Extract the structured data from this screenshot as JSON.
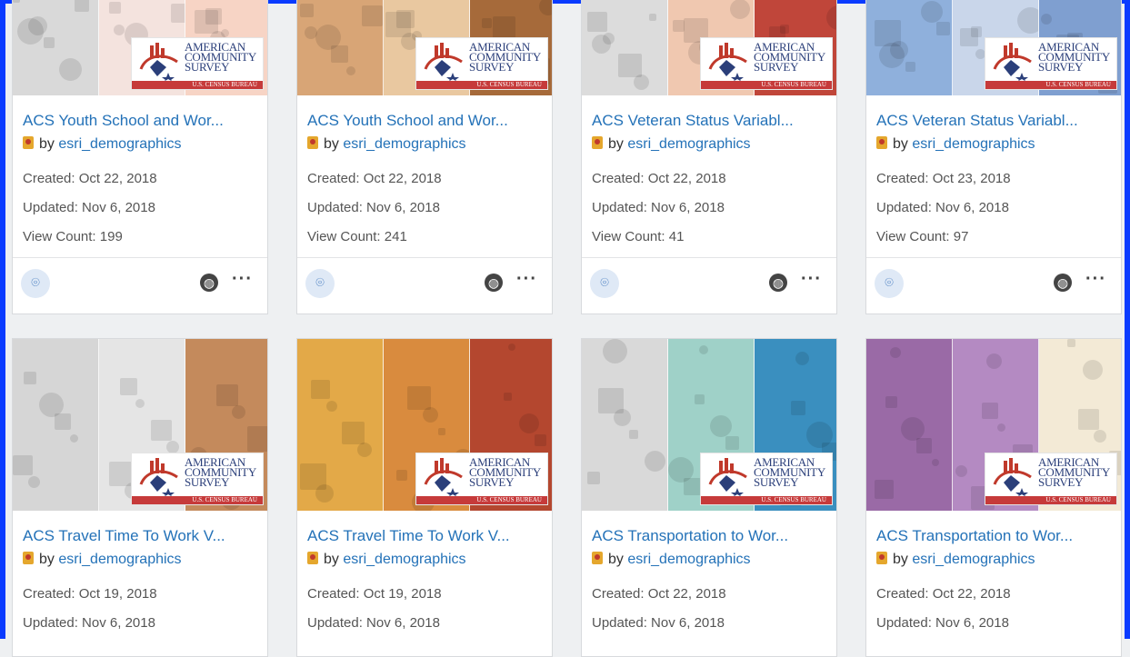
{
  "cards": [
    {
      "title": "ACS Youth School and Wor...",
      "owner_prefix": "by",
      "owner": "esri_demographics",
      "created": "Created: Oct 22, 2018",
      "updated": "Updated: Nov 6, 2018",
      "views": "View Count: 199",
      "thumb_colors": [
        "#d9d9d9",
        "#f4e3de",
        "#f7d4c5"
      ]
    },
    {
      "title": "ACS Youth School and Wor...",
      "owner_prefix": "by",
      "owner": "esri_demographics",
      "created": "Created: Oct 22, 2018",
      "updated": "Updated: Nov 6, 2018",
      "views": "View Count: 241",
      "thumb_colors": [
        "#d8a576",
        "#e9c8a0",
        "#a66a3a"
      ]
    },
    {
      "title": "ACS Veteran Status Variabl...",
      "owner_prefix": "by",
      "owner": "esri_demographics",
      "created": "Created: Oct 22, 2018",
      "updated": "Updated: Nov 6, 2018",
      "views": "View Count: 41",
      "thumb_colors": [
        "#dcdcdc",
        "#f0c8b0",
        "#c0463a"
      ]
    },
    {
      "title": "ACS Veteran Status Variabl...",
      "owner_prefix": "by",
      "owner": "esri_demographics",
      "created": "Created: Oct 23, 2018",
      "updated": "Updated: Nov 6, 2018",
      "views": "View Count: 97",
      "thumb_colors": [
        "#8fb0dc",
        "#c9d6ea",
        "#7f9fd0"
      ]
    },
    {
      "title": "ACS Travel Time To Work V...",
      "owner_prefix": "by",
      "owner": "esri_demographics",
      "created": "Created: Oct 19, 2018",
      "updated": "Updated: Nov 6, 2018",
      "views": "",
      "thumb_colors": [
        "#d6d6d6",
        "#e5e5e5",
        "#c48a5c"
      ]
    },
    {
      "title": "ACS Travel Time To Work V...",
      "owner_prefix": "by",
      "owner": "esri_demographics",
      "created": "Created: Oct 19, 2018",
      "updated": "Updated: Nov 6, 2018",
      "views": "",
      "thumb_colors": [
        "#e3a948",
        "#d98b3e",
        "#b4472f"
      ]
    },
    {
      "title": "ACS Transportation to Wor...",
      "owner_prefix": "by",
      "owner": "esri_demographics",
      "created": "Created: Oct 22, 2018",
      "updated": "Updated: Nov 6, 2018",
      "views": "",
      "thumb_colors": [
        "#d9d9d9",
        "#9fd1c8",
        "#3a8fbf"
      ]
    },
    {
      "title": "ACS Transportation to Wor...",
      "owner_prefix": "by",
      "owner": "esri_demographics",
      "created": "Created: Oct 22, 2018",
      "updated": "Updated: Nov 6, 2018",
      "views": "",
      "thumb_colors": [
        "#9a6aa6",
        "#b48ac2",
        "#f3ead6"
      ]
    }
  ],
  "logo": {
    "line1": "AMERICAN",
    "line2": "COMMUNITY",
    "line3": "SURVEY",
    "sub": "U.S. CENSUS BUREAU"
  },
  "icons": {
    "type_badge": "map-app-icon",
    "share": "globe-icon",
    "more": "more-options-icon"
  },
  "colors": {
    "frame": "#0a3bff",
    "title_link": "#2472b8"
  }
}
